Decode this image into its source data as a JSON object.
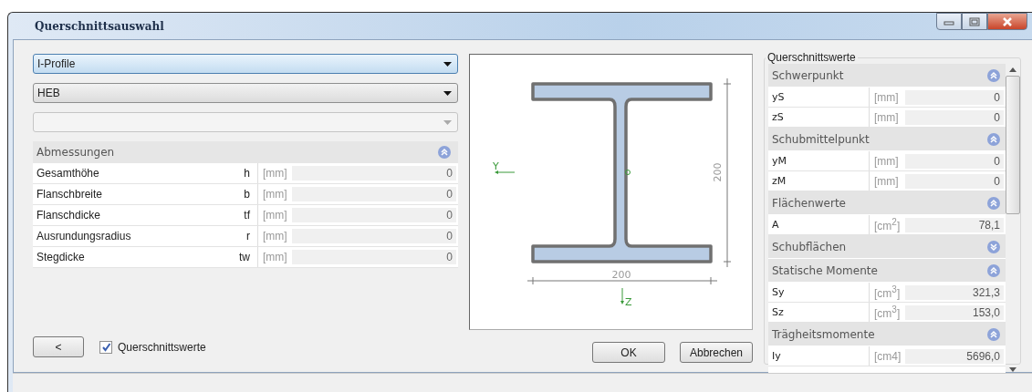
{
  "window": {
    "title": "Querschnittsauswahl"
  },
  "dropdowns": [
    {
      "value": "I-Profile",
      "focused": true,
      "disabled": false
    },
    {
      "value": "HEB",
      "focused": false,
      "disabled": false
    },
    {
      "focused": false,
      "disabled": true
    }
  ],
  "dimensions": {
    "title": "Abmessungen",
    "expanded": true,
    "rows": [
      {
        "label": "Gesamthöhe",
        "symbol": "h",
        "unit": "[mm]",
        "value": "0"
      },
      {
        "label": "Flanschbreite",
        "symbol": "b",
        "unit": "[mm]",
        "value": "0"
      },
      {
        "label": "Flanschdicke",
        "symbol": "tf",
        "unit": "[mm]",
        "value": "0"
      },
      {
        "label": "Ausrundungsradius",
        "symbol": "r",
        "unit": "[mm]",
        "value": "0"
      },
      {
        "label": "Stegdicke",
        "symbol": "tw",
        "unit": "[mm]",
        "value": "0"
      }
    ]
  },
  "drawing": {
    "y_axis": "Y",
    "z_axis": "Z",
    "height_label": "200",
    "width_label": "200"
  },
  "back_button": "<",
  "show_values": {
    "label": "Querschnittswerte",
    "checked": true
  },
  "buttons": [
    "OK",
    "Abbrechen"
  ],
  "values_panel": {
    "title": "Querschnittswerte",
    "sections": [
      {
        "title": "Schwerpunkt",
        "expanded": true,
        "rows": [
          {
            "label": "yS",
            "unit": "[mm]",
            "value": "0"
          },
          {
            "label": "zS",
            "unit": "[mm]",
            "value": "0"
          }
        ]
      },
      {
        "title": "Schubmittelpunkt",
        "expanded": true,
        "rows": [
          {
            "label": "yM",
            "unit": "[mm]",
            "value": "0"
          },
          {
            "label": "zM",
            "unit": "[mm]",
            "value": "0"
          }
        ]
      },
      {
        "title": "Flächenwerte",
        "expanded": true,
        "rows": [
          {
            "label": "A",
            "unit": "[cm$^{2}$]",
            "value": "78,1"
          }
        ]
      },
      {
        "title": "Schubflächen",
        "expanded": false
      },
      {
        "title": "Statische Momente",
        "expanded": true,
        "rows": [
          {
            "label": "Sy",
            "unit": "[cm$^{3}$]",
            "value": "321,3"
          },
          {
            "label": "Sz",
            "unit": "[cm$^{3}$]",
            "value": "153,0"
          }
        ]
      },
      {
        "title": "Trägheitsmomente",
        "expanded": true,
        "rows": [
          {
            "label": "Iy",
            "unit": "[cm4]",
            "value": "5696,0"
          }
        ]
      }
    ]
  }
}
